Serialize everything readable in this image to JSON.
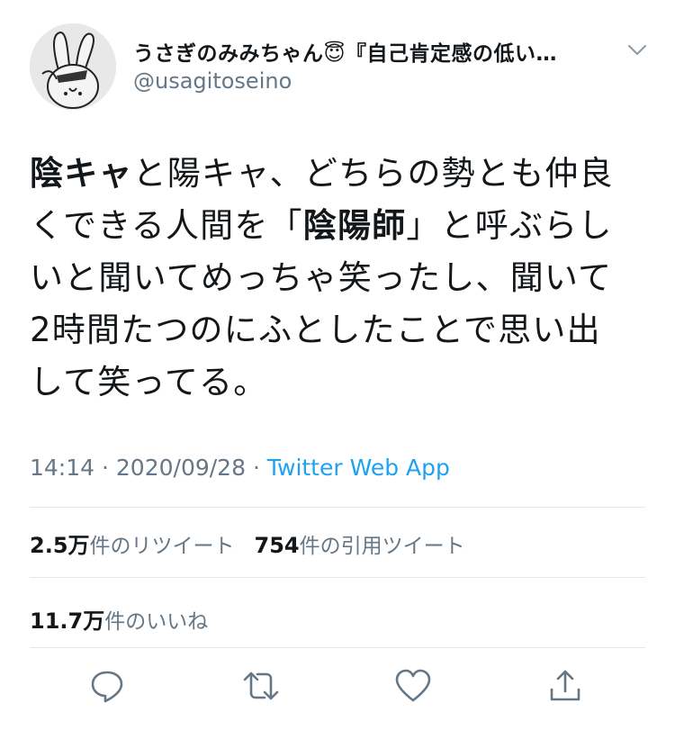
{
  "author": {
    "display_name": "うさぎのみみちゃん😇『自己肯定感の低い…",
    "handle": "@usagitoseino"
  },
  "tweet": {
    "lines": [
      [
        {
          "t": "陰キャ",
          "b": true
        },
        {
          "t": "と陽キャ、どちらの勢とも仲良",
          "b": false
        }
      ],
      [
        {
          "t": "くできる人間を「",
          "b": false
        },
        {
          "t": "陰陽師",
          "b": true
        },
        {
          "t": "」と呼ぶらし",
          "b": false
        }
      ],
      [
        {
          "t": "いと聞いてめっちゃ笑ったし、聞いて",
          "b": false
        }
      ],
      [
        {
          "t": "2時間たつのにふとしたことで思い出",
          "b": false
        }
      ],
      [
        {
          "t": "して笑ってる。",
          "b": false
        }
      ]
    ]
  },
  "meta": {
    "time": "14:14",
    "separator": "·",
    "date": "2020/09/28",
    "source": "Twitter Web App"
  },
  "stats": {
    "retweets_count": "2.5万",
    "retweets_label": "件のリツイート",
    "quotes_count": "754",
    "quotes_label": "件の引用ツイート",
    "likes_count": "11.7万",
    "likes_label": "件のいいね"
  },
  "actions": [
    "reply-icon",
    "retweet-icon",
    "like-icon",
    "share-icon"
  ],
  "colors": {
    "text": "#14171a",
    "secondary": "#657786",
    "link": "#1da1f2",
    "divider": "#e1e8ed"
  }
}
